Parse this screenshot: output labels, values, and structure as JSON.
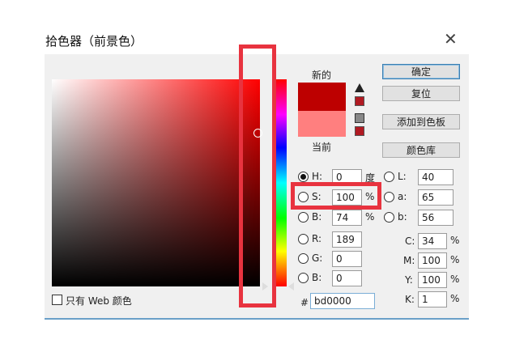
{
  "dialog": {
    "title": "拾色器（前景色）",
    "close_glyph": "✕"
  },
  "preview": {
    "new_label": "新的",
    "current_label": "当前",
    "new_color": "#bd0000",
    "current_color": "#ff7f7f"
  },
  "buttons": {
    "ok": "确定",
    "reset": "复位",
    "add_swatch": "添加到色板",
    "color_library": "颜色库"
  },
  "hsb": {
    "h": {
      "label": "H:",
      "value": "0",
      "unit": "度"
    },
    "s": {
      "label": "S:",
      "value": "100",
      "unit": "%"
    },
    "b": {
      "label": "B:",
      "value": "74",
      "unit": "%"
    }
  },
  "rgb": {
    "r": {
      "label": "R:",
      "value": "189"
    },
    "g": {
      "label": "G:",
      "value": "0"
    },
    "b": {
      "label": "B:",
      "value": "0"
    }
  },
  "lab": {
    "l": {
      "label": "L:",
      "value": "40"
    },
    "a": {
      "label": "a:",
      "value": "65"
    },
    "b": {
      "label": "b:",
      "value": "56"
    }
  },
  "cmyk": {
    "c": {
      "label": "C:",
      "value": "34",
      "unit": "%"
    },
    "m": {
      "label": "M:",
      "value": "100",
      "unit": "%"
    },
    "y": {
      "label": "Y:",
      "value": "100",
      "unit": "%"
    },
    "k": {
      "label": "K:",
      "value": "1",
      "unit": "%"
    }
  },
  "hex": {
    "prefix": "#",
    "value": "bd0000"
  },
  "web_only": {
    "label": "只有 Web 颜色"
  },
  "colors": {
    "highlight": "#e8333f",
    "out_of_gamut_chip": "#b11a22"
  },
  "icons": {
    "gamut_warning": "warning-triangle-icon",
    "web_safe": "cube-icon"
  }
}
